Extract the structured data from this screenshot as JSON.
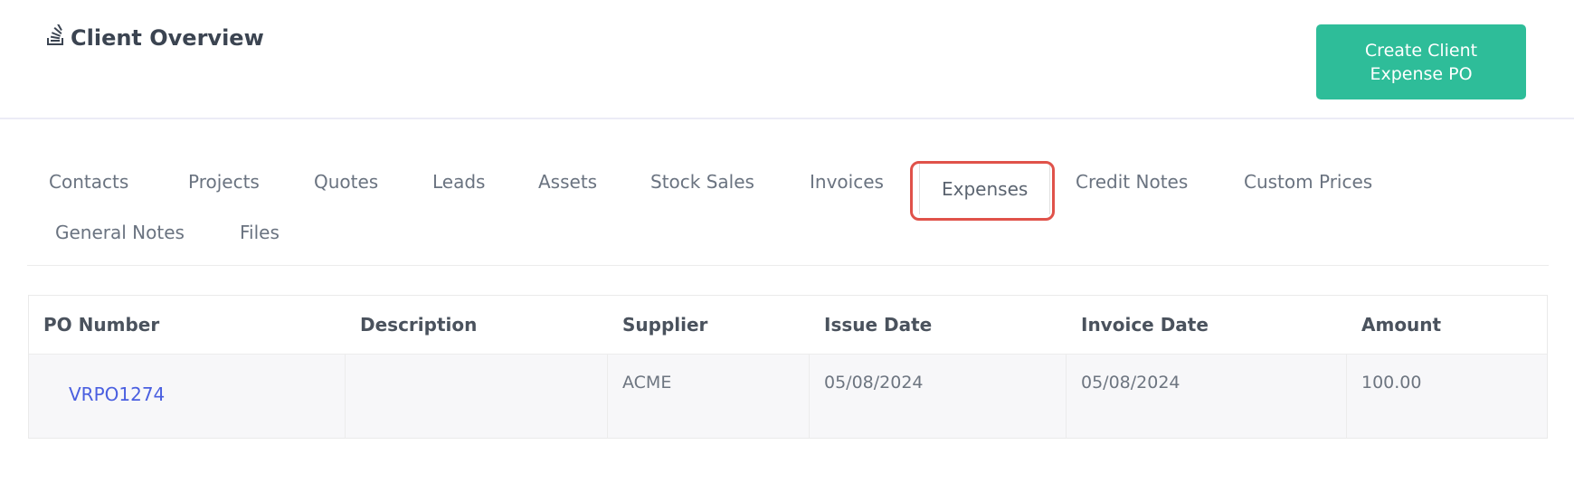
{
  "header": {
    "title": "Client Overview",
    "title_icon": "stack-overflow-icon",
    "create_button_label": "Create Client Expense PO",
    "accent_color": "#2ebd99"
  },
  "tabs": [
    {
      "label": "Contacts"
    },
    {
      "label": "Projects"
    },
    {
      "label": "Quotes"
    },
    {
      "label": "Leads"
    },
    {
      "label": "Assets"
    },
    {
      "label": "Stock Sales"
    },
    {
      "label": "Invoices"
    },
    {
      "label": "Expenses",
      "active": true
    },
    {
      "label": "Credit Notes"
    },
    {
      "label": "Custom Prices"
    },
    {
      "label": "General Notes"
    },
    {
      "label": "Files"
    }
  ],
  "table": {
    "columns": [
      "PO Number",
      "Description",
      "Supplier",
      "Issue Date",
      "Invoice Date",
      "Amount"
    ],
    "rows": [
      {
        "po_number": "VRPO1274",
        "description": "",
        "supplier": "ACME",
        "issue_date": "05/08/2024",
        "invoice_date": "05/08/2024",
        "amount": "100.00"
      }
    ]
  },
  "highlight_color": "#e0524a"
}
